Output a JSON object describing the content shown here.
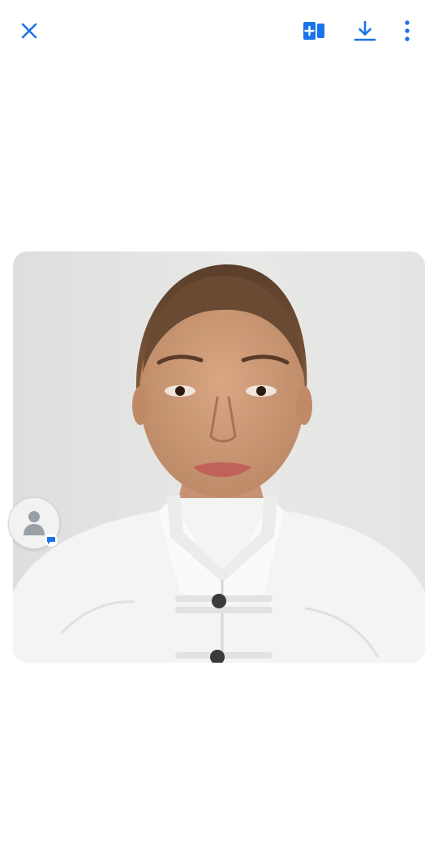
{
  "toolbar": {
    "close_icon": "close-icon",
    "add_page_icon": "add-to-document-icon",
    "download_icon": "download-icon",
    "more_icon": "more-vertical-icon"
  },
  "viewer": {
    "photo": "portrait-photo",
    "avatar_icon": "person-icon",
    "avatar_badge_icon": "chat-bubble-icon"
  },
  "colors": {
    "accent": "#1a73e8",
    "background": "#ffffff",
    "photo_backdrop": "#e6e6e4",
    "avatar_grey": "#9aa0a6"
  }
}
